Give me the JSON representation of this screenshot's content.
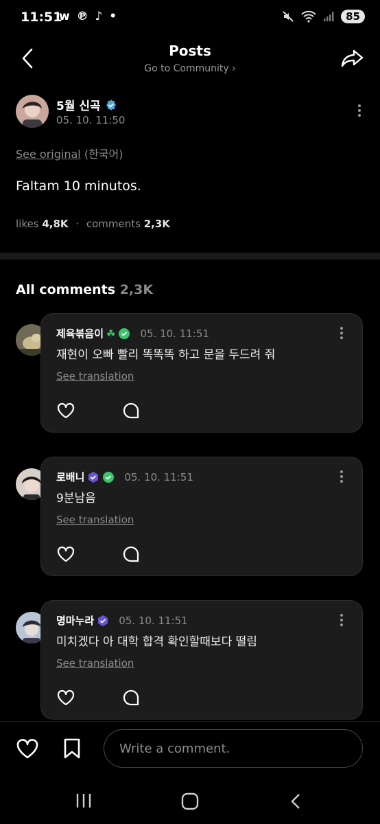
{
  "status": {
    "time": "11:51",
    "apps": "w ℗ ♪ •",
    "battery": "85"
  },
  "header": {
    "title": "Posts",
    "subtitle": "Go to Community ›"
  },
  "post": {
    "author": "5월 신곡",
    "time": "05. 10. 11:50",
    "see_original": "See original",
    "language": "(한국어)",
    "body": "Faltam 10 minutos.",
    "likes_label": "likes",
    "likes_value": "4,8K",
    "comments_label": "comments",
    "comments_value": "2,3K"
  },
  "comments_header": {
    "label": "All comments",
    "count": "2,3K"
  },
  "comments": [
    {
      "name": "제육볶음이",
      "badge": "☘",
      "time": "05. 10. 11:51",
      "text": "재현이 오빠 빨리 똑똑똑 하고 문을 두드려 줘",
      "translate": "See translation"
    },
    {
      "name": "로배니",
      "time": "05. 10. 11:51",
      "text": "9분남음",
      "translate": "See translation"
    },
    {
      "name": "명마누라",
      "time": "05. 10. 11:51",
      "text": "미치겠다 아 대학 합격 확인할때보다 떨림",
      "translate": "See translation"
    }
  ],
  "composer": {
    "placeholder": "Write a comment."
  },
  "colors": {
    "background": "#000000",
    "card": "#1c1c1c",
    "verified_blue": "#4fa3e0",
    "verified_green": "#3cc46a",
    "verified_purple": "#6a55d8"
  }
}
